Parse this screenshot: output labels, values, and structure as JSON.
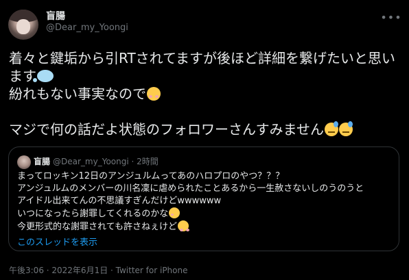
{
  "author": {
    "display_name": "盲腸",
    "handle": "@Dear_my_Yoongi"
  },
  "tweet": {
    "lines": [
      "着々と鍵垢から引RTされてますが後ほど詳細を繋げたいと思います",
      "紛れもない事実なので",
      "",
      "マジで何の話だよ状態のフォロワーさんすみません"
    ],
    "emojis": [
      "thought-balloon",
      "smiling-face-blush",
      "sweat-face",
      "sweat-face"
    ]
  },
  "quoted_tweet": {
    "display_name": "盲腸",
    "handle_and_time": "@Dear_my_Yoongi · 2時間",
    "lines": [
      "まってロッキン12日のアンジュルムってあのハロプロのやつ？？？",
      "アンジュルムのメンバーの川名凜に虐められたことあるから一生赦さないしのうのうと",
      "アイドル出来てんの不思議すぎんだけどwwwwww",
      "いつになったら謝罪してくれるのかな",
      "今更形式的な謝罪されても許さねぇけど"
    ],
    "show_thread_link": "このスレッドを表示"
  },
  "meta": {
    "timestamp": "午後3:06 · 2022年6月1日 · Twitter for iPhone"
  }
}
